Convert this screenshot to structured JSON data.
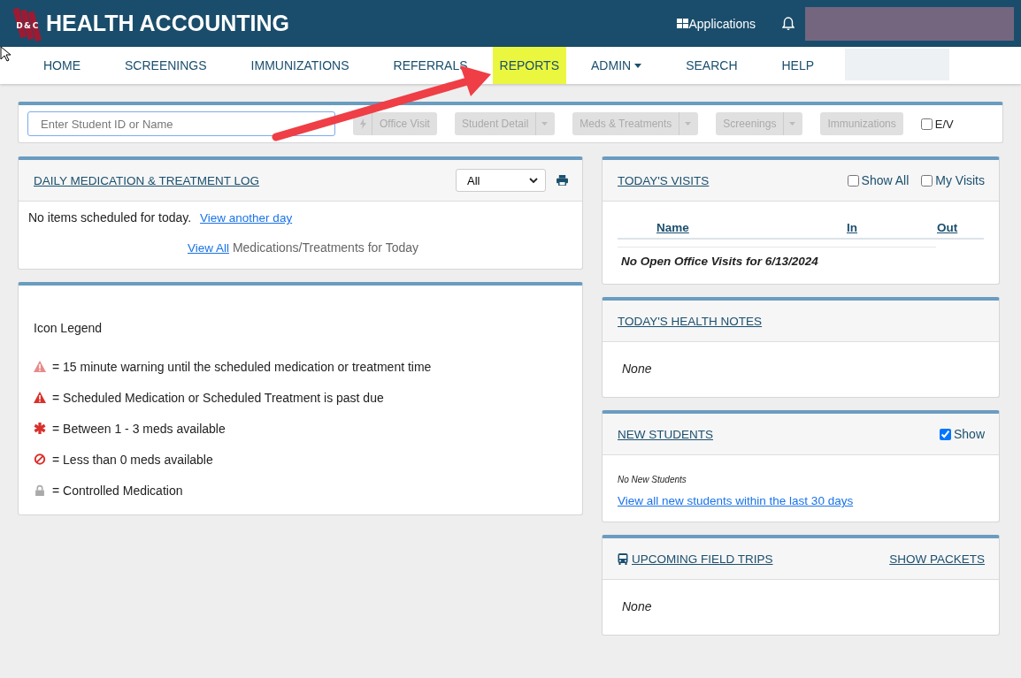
{
  "header": {
    "logo_letters": [
      "D",
      "&",
      "C"
    ],
    "title": "HEALTH ACCOUNTING",
    "apps_label": "Applications"
  },
  "nav": [
    {
      "label": "HOME",
      "highlighted": false,
      "dropdown": false
    },
    {
      "label": "SCREENINGS",
      "highlighted": false,
      "dropdown": false
    },
    {
      "label": "IMMUNIZATIONS",
      "highlighted": false,
      "dropdown": false
    },
    {
      "label": "REFERRALS",
      "highlighted": false,
      "dropdown": false
    },
    {
      "label": "REPORTS",
      "highlighted": true,
      "dropdown": false
    },
    {
      "label": "ADMIN",
      "highlighted": false,
      "dropdown": true
    },
    {
      "label": "SEARCH",
      "highlighted": false,
      "dropdown": false
    },
    {
      "label": "HELP",
      "highlighted": false,
      "dropdown": false
    }
  ],
  "toolbar": {
    "search": {
      "placeholder": "Enter Student ID or Name"
    },
    "buttons": [
      {
        "kind": "bolt",
        "label": "Office Visit",
        "disabled": true
      },
      {
        "kind": "split",
        "label": "Student Detail",
        "disabled": true
      },
      {
        "kind": "split",
        "label": "Meds & Treatments",
        "disabled": true
      },
      {
        "kind": "split",
        "label": "Screenings",
        "disabled": true
      },
      {
        "kind": "plain",
        "label": "Immunizations",
        "disabled": true
      }
    ],
    "ev": {
      "label": "E/V",
      "checked": false
    }
  },
  "med_log": {
    "title": "DAILY MEDICATION & TREATMENT LOG",
    "filter": "All",
    "message": "No items scheduled for today.",
    "message_link": "View another day",
    "view_all_link": "View All",
    "view_all_text": "Medications/Treatments for Today"
  },
  "legend": {
    "title": "Icon Legend",
    "items": [
      {
        "kind": "warning-light",
        "text": "= 15 minute warning until the scheduled medication or treatment time"
      },
      {
        "kind": "warning",
        "text": "= Scheduled Medication or Scheduled Treatment is past due"
      },
      {
        "kind": "asterisk",
        "text": "= Between 1 - 3 meds available"
      },
      {
        "kind": "ban",
        "text": "= Less than 0 meds available"
      },
      {
        "kind": "lock",
        "text": "= Controlled Medication"
      }
    ]
  },
  "visits": {
    "title": "TODAY'S VISITS",
    "options": [
      {
        "label": "Show All",
        "checked": false
      },
      {
        "label": "My Visits",
        "checked": false
      }
    ],
    "columns": [
      "Name",
      "In",
      "Out"
    ],
    "empty": "No Open Office Visits for 6/13/2024"
  },
  "health_notes": {
    "title": "TODAY'S HEALTH NOTES",
    "empty": "None"
  },
  "new_students": {
    "title": "NEW STUDENTS",
    "show": {
      "label": "Show",
      "checked": true
    },
    "empty": "No New Students",
    "link": "View all new students within the last 30 days"
  },
  "field_trips": {
    "title": "UPCOMING FIELD TRIPS",
    "action": "SHOW PACKETS",
    "empty": "None"
  }
}
